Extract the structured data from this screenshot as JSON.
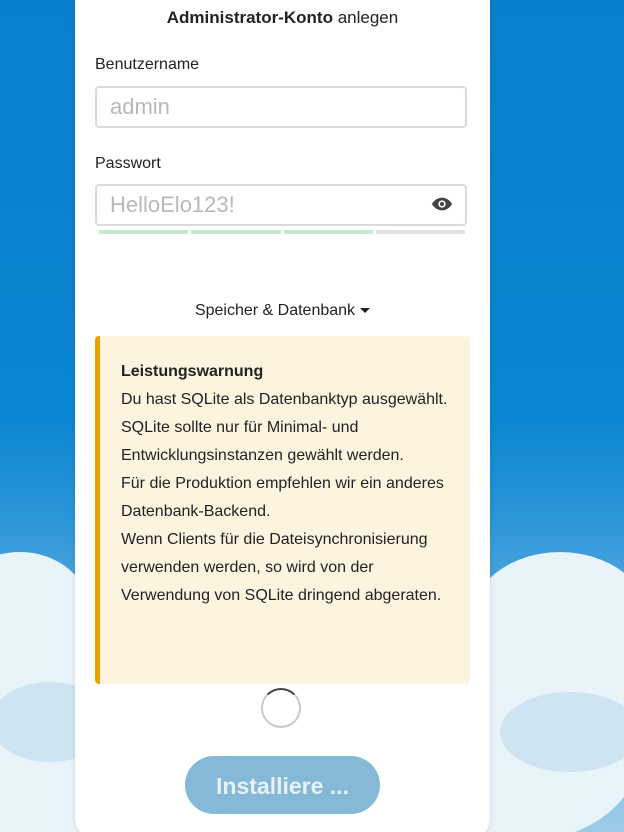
{
  "form": {
    "title_bold": "Administrator-Konto",
    "title_rest": " anlegen",
    "username_label": "Benutzername",
    "username_placeholder": "admin",
    "password_label": "Passwort",
    "password_value": "HelloElo123!",
    "password_strength": 0.75,
    "strength_colors": [
      "#c5e9cc",
      "#c5e9cc",
      "#c5e9cc",
      "#e2e2e2"
    ]
  },
  "storage": {
    "toggle_label": "Speicher & Datenbank"
  },
  "warning": {
    "title": "Leistungswarnung",
    "lines": [
      "Du hast SQLite als Datenbanktyp ausgewählt.",
      "SQLite sollte nur für Minimal- und Entwicklungsinstanzen gewählt werden.",
      "Für die Produktion empfehlen wir ein anderes Datenbank-Backend.",
      "Wenn Clients für die Dateisynchronisierung verwenden werden, so wird von der Verwendung von SQLite dringend abgeraten."
    ],
    "accent_color": "#e9a000",
    "background_color": "#fdf4e0"
  },
  "install": {
    "label": "Installiere ...",
    "color": "#86b9d8"
  },
  "icons": {
    "password_toggle": "eye-icon",
    "dropdown": "caret-down-icon",
    "loading": "spinner-icon"
  }
}
